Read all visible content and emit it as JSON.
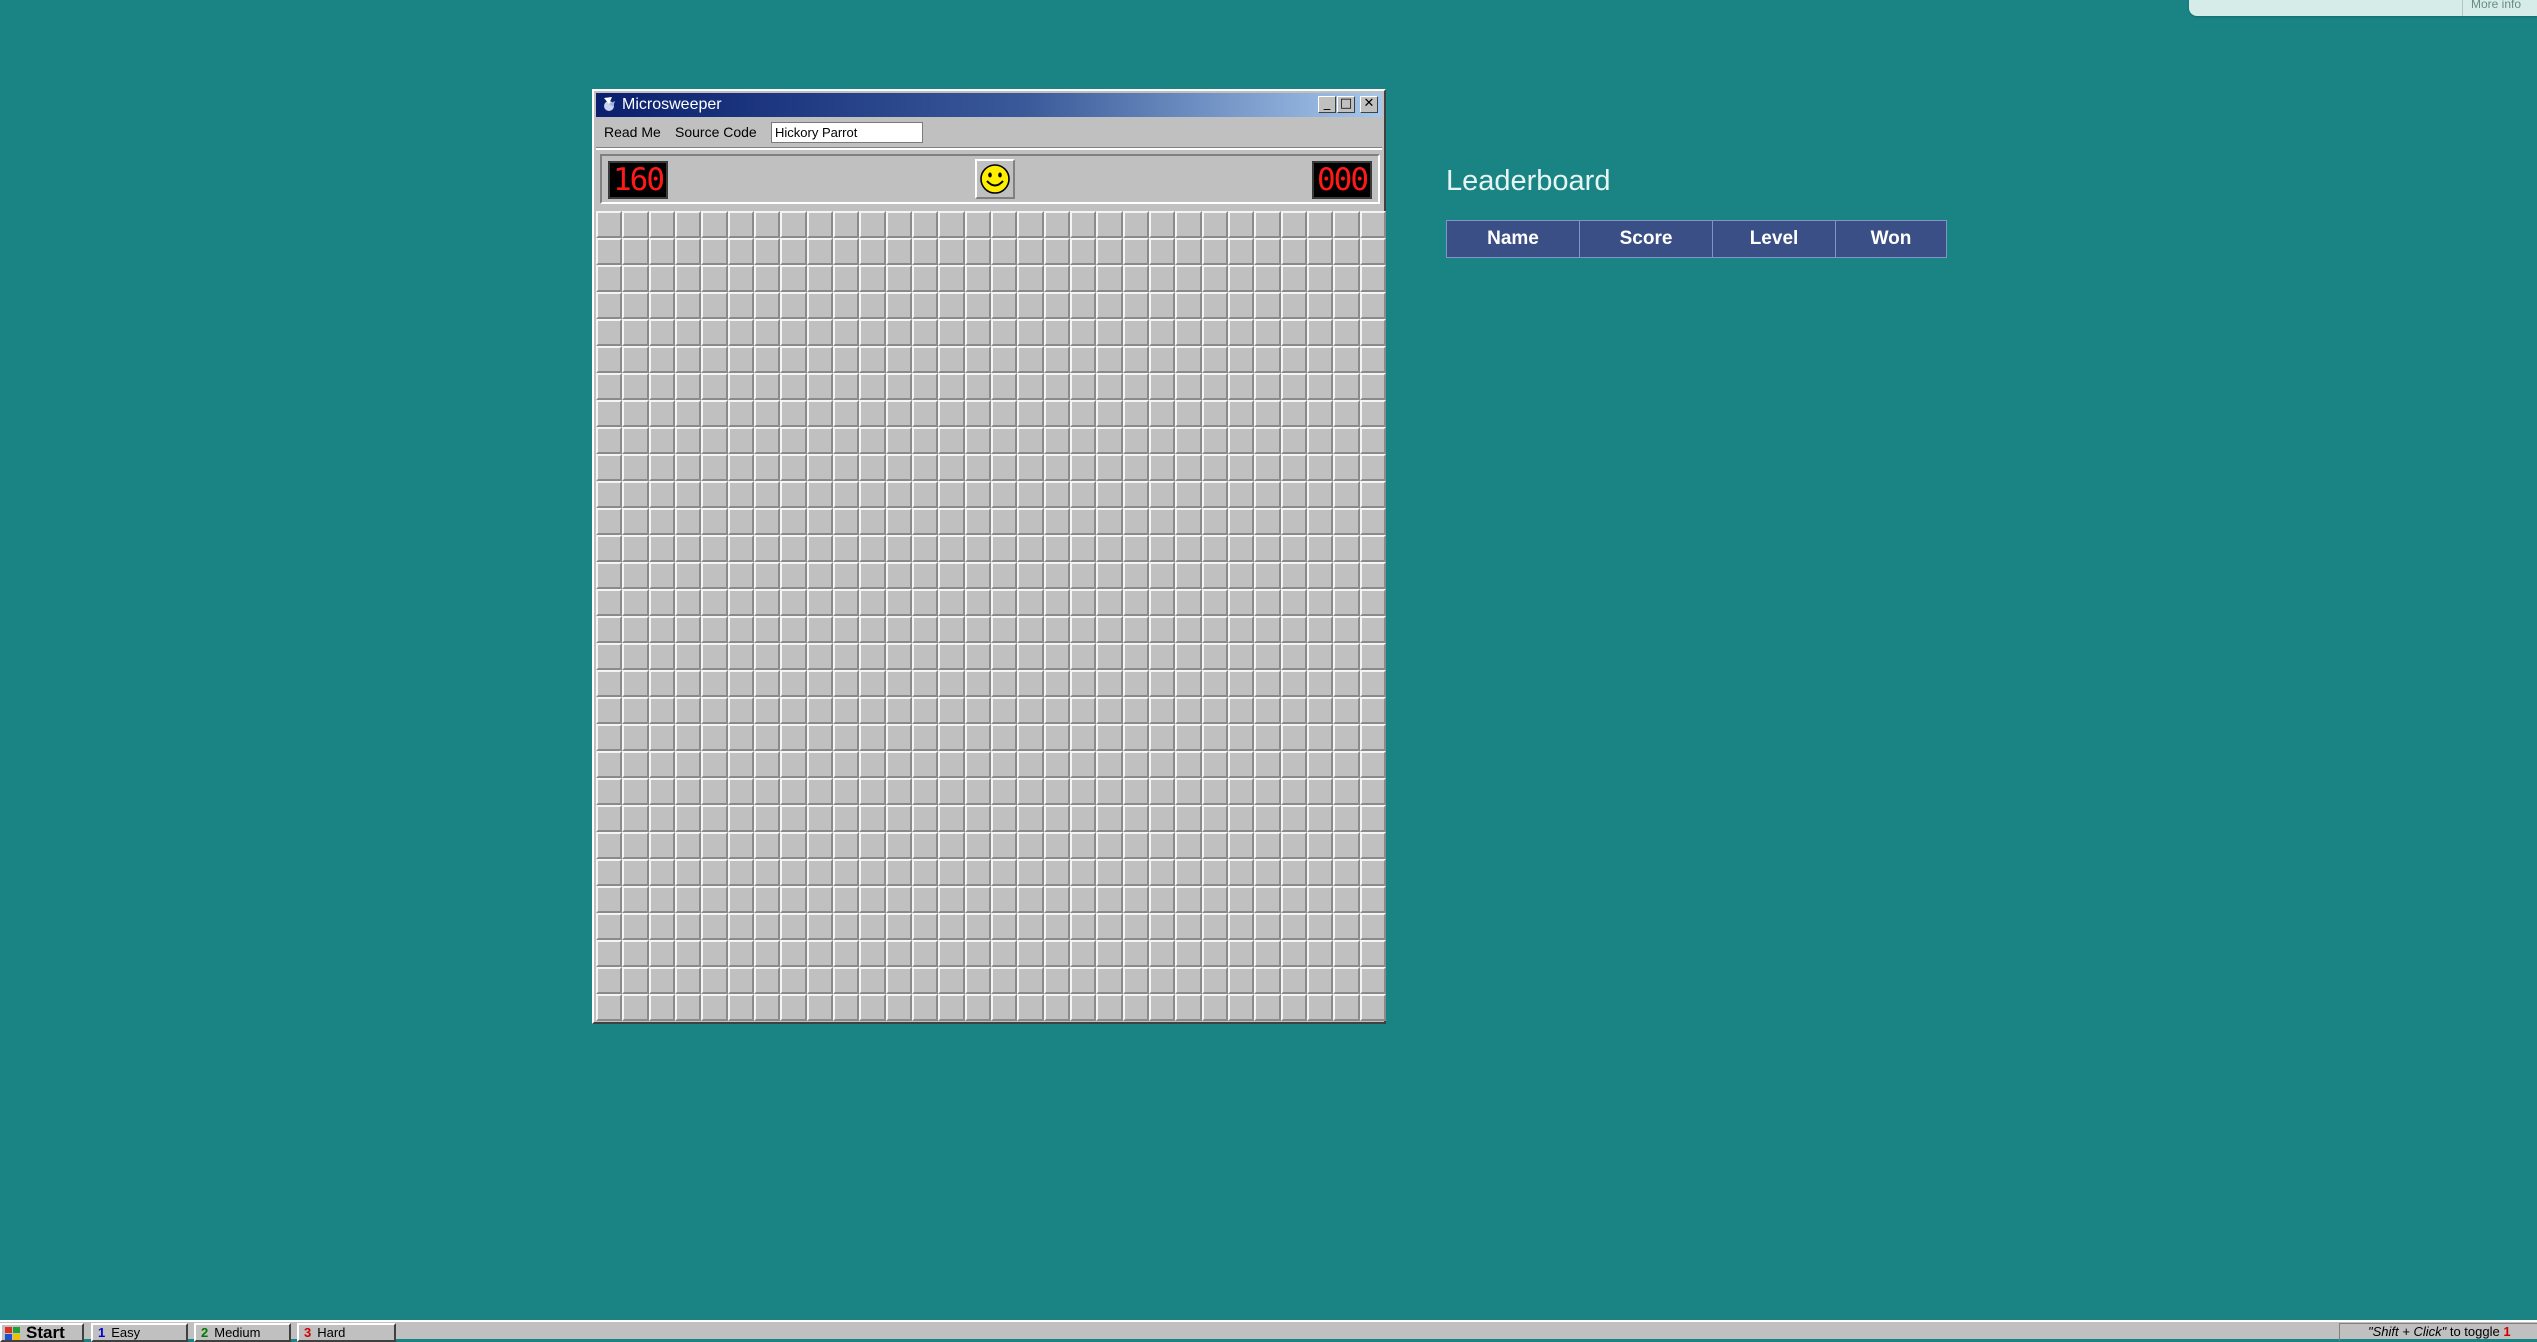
{
  "top_tab": {
    "label": "More info"
  },
  "window": {
    "title": "Microsweeper",
    "controls": {
      "minimize": "_",
      "maximize": "□",
      "close": "✕"
    }
  },
  "menu": {
    "read_me": "Read Me",
    "source_code": "Source Code",
    "player_name": "Hickory Parrot"
  },
  "status": {
    "mines_remaining": "160",
    "timer": "000",
    "face": "smiley"
  },
  "grid": {
    "columns": 30,
    "rows": 30,
    "state": "all-covered"
  },
  "leaderboard": {
    "title": "Leaderboard",
    "columns": [
      "Name",
      "Score",
      "Level",
      "Won"
    ]
  },
  "taskbar": {
    "start": "Start",
    "tasks": [
      {
        "num": "1",
        "label": "Easy",
        "color": "#0000cc"
      },
      {
        "num": "2",
        "label": "Medium",
        "color": "#007a00"
      },
      {
        "num": "3",
        "label": "Hard",
        "color": "#cc0000"
      }
    ],
    "tray": {
      "tip": "\"Shift + Click\"",
      "rest": " to toggle ",
      "flag": "1"
    }
  },
  "colors": {
    "desktop": "#1a8484",
    "titlebar_start": "#0a1f6e",
    "led_text": "#ff1a1a",
    "leaderboard_header": "#3a4f86"
  }
}
